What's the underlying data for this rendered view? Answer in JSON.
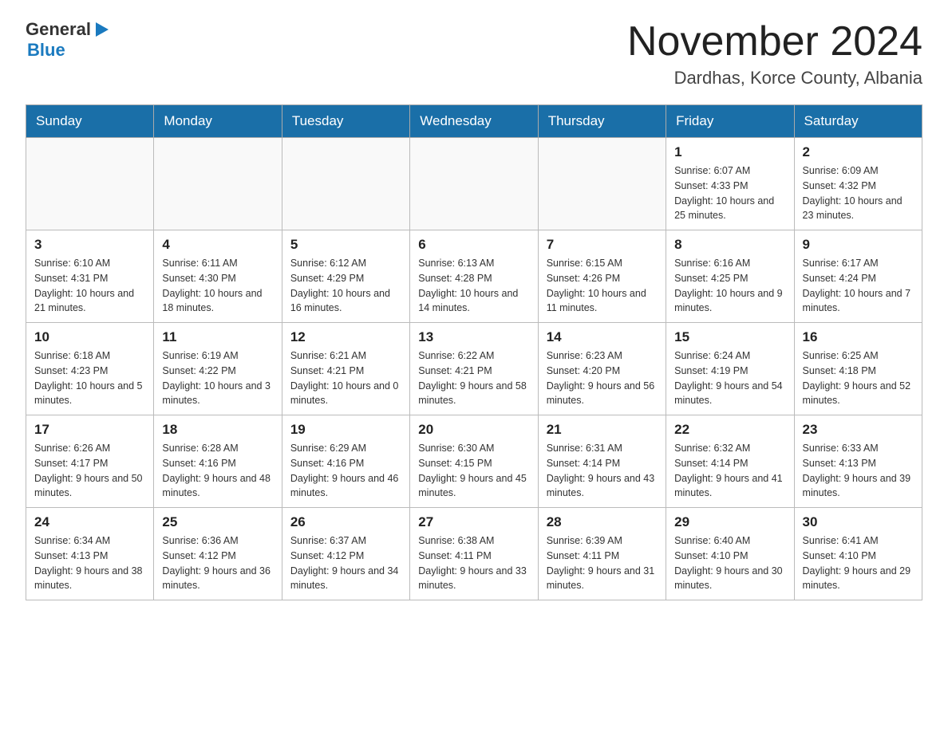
{
  "logo": {
    "general": "General",
    "blue": "Blue",
    "arrow": "▶"
  },
  "title": "November 2024",
  "subtitle": "Dardhas, Korce County, Albania",
  "days_of_week": [
    "Sunday",
    "Monday",
    "Tuesday",
    "Wednesday",
    "Thursday",
    "Friday",
    "Saturday"
  ],
  "weeks": [
    [
      {
        "day": "",
        "info": ""
      },
      {
        "day": "",
        "info": ""
      },
      {
        "day": "",
        "info": ""
      },
      {
        "day": "",
        "info": ""
      },
      {
        "day": "",
        "info": ""
      },
      {
        "day": "1",
        "info": "Sunrise: 6:07 AM\nSunset: 4:33 PM\nDaylight: 10 hours and 25 minutes."
      },
      {
        "day": "2",
        "info": "Sunrise: 6:09 AM\nSunset: 4:32 PM\nDaylight: 10 hours and 23 minutes."
      }
    ],
    [
      {
        "day": "3",
        "info": "Sunrise: 6:10 AM\nSunset: 4:31 PM\nDaylight: 10 hours and 21 minutes."
      },
      {
        "day": "4",
        "info": "Sunrise: 6:11 AM\nSunset: 4:30 PM\nDaylight: 10 hours and 18 minutes."
      },
      {
        "day": "5",
        "info": "Sunrise: 6:12 AM\nSunset: 4:29 PM\nDaylight: 10 hours and 16 minutes."
      },
      {
        "day": "6",
        "info": "Sunrise: 6:13 AM\nSunset: 4:28 PM\nDaylight: 10 hours and 14 minutes."
      },
      {
        "day": "7",
        "info": "Sunrise: 6:15 AM\nSunset: 4:26 PM\nDaylight: 10 hours and 11 minutes."
      },
      {
        "day": "8",
        "info": "Sunrise: 6:16 AM\nSunset: 4:25 PM\nDaylight: 10 hours and 9 minutes."
      },
      {
        "day": "9",
        "info": "Sunrise: 6:17 AM\nSunset: 4:24 PM\nDaylight: 10 hours and 7 minutes."
      }
    ],
    [
      {
        "day": "10",
        "info": "Sunrise: 6:18 AM\nSunset: 4:23 PM\nDaylight: 10 hours and 5 minutes."
      },
      {
        "day": "11",
        "info": "Sunrise: 6:19 AM\nSunset: 4:22 PM\nDaylight: 10 hours and 3 minutes."
      },
      {
        "day": "12",
        "info": "Sunrise: 6:21 AM\nSunset: 4:21 PM\nDaylight: 10 hours and 0 minutes."
      },
      {
        "day": "13",
        "info": "Sunrise: 6:22 AM\nSunset: 4:21 PM\nDaylight: 9 hours and 58 minutes."
      },
      {
        "day": "14",
        "info": "Sunrise: 6:23 AM\nSunset: 4:20 PM\nDaylight: 9 hours and 56 minutes."
      },
      {
        "day": "15",
        "info": "Sunrise: 6:24 AM\nSunset: 4:19 PM\nDaylight: 9 hours and 54 minutes."
      },
      {
        "day": "16",
        "info": "Sunrise: 6:25 AM\nSunset: 4:18 PM\nDaylight: 9 hours and 52 minutes."
      }
    ],
    [
      {
        "day": "17",
        "info": "Sunrise: 6:26 AM\nSunset: 4:17 PM\nDaylight: 9 hours and 50 minutes."
      },
      {
        "day": "18",
        "info": "Sunrise: 6:28 AM\nSunset: 4:16 PM\nDaylight: 9 hours and 48 minutes."
      },
      {
        "day": "19",
        "info": "Sunrise: 6:29 AM\nSunset: 4:16 PM\nDaylight: 9 hours and 46 minutes."
      },
      {
        "day": "20",
        "info": "Sunrise: 6:30 AM\nSunset: 4:15 PM\nDaylight: 9 hours and 45 minutes."
      },
      {
        "day": "21",
        "info": "Sunrise: 6:31 AM\nSunset: 4:14 PM\nDaylight: 9 hours and 43 minutes."
      },
      {
        "day": "22",
        "info": "Sunrise: 6:32 AM\nSunset: 4:14 PM\nDaylight: 9 hours and 41 minutes."
      },
      {
        "day": "23",
        "info": "Sunrise: 6:33 AM\nSunset: 4:13 PM\nDaylight: 9 hours and 39 minutes."
      }
    ],
    [
      {
        "day": "24",
        "info": "Sunrise: 6:34 AM\nSunset: 4:13 PM\nDaylight: 9 hours and 38 minutes."
      },
      {
        "day": "25",
        "info": "Sunrise: 6:36 AM\nSunset: 4:12 PM\nDaylight: 9 hours and 36 minutes."
      },
      {
        "day": "26",
        "info": "Sunrise: 6:37 AM\nSunset: 4:12 PM\nDaylight: 9 hours and 34 minutes."
      },
      {
        "day": "27",
        "info": "Sunrise: 6:38 AM\nSunset: 4:11 PM\nDaylight: 9 hours and 33 minutes."
      },
      {
        "day": "28",
        "info": "Sunrise: 6:39 AM\nSunset: 4:11 PM\nDaylight: 9 hours and 31 minutes."
      },
      {
        "day": "29",
        "info": "Sunrise: 6:40 AM\nSunset: 4:10 PM\nDaylight: 9 hours and 30 minutes."
      },
      {
        "day": "30",
        "info": "Sunrise: 6:41 AM\nSunset: 4:10 PM\nDaylight: 9 hours and 29 minutes."
      }
    ]
  ]
}
